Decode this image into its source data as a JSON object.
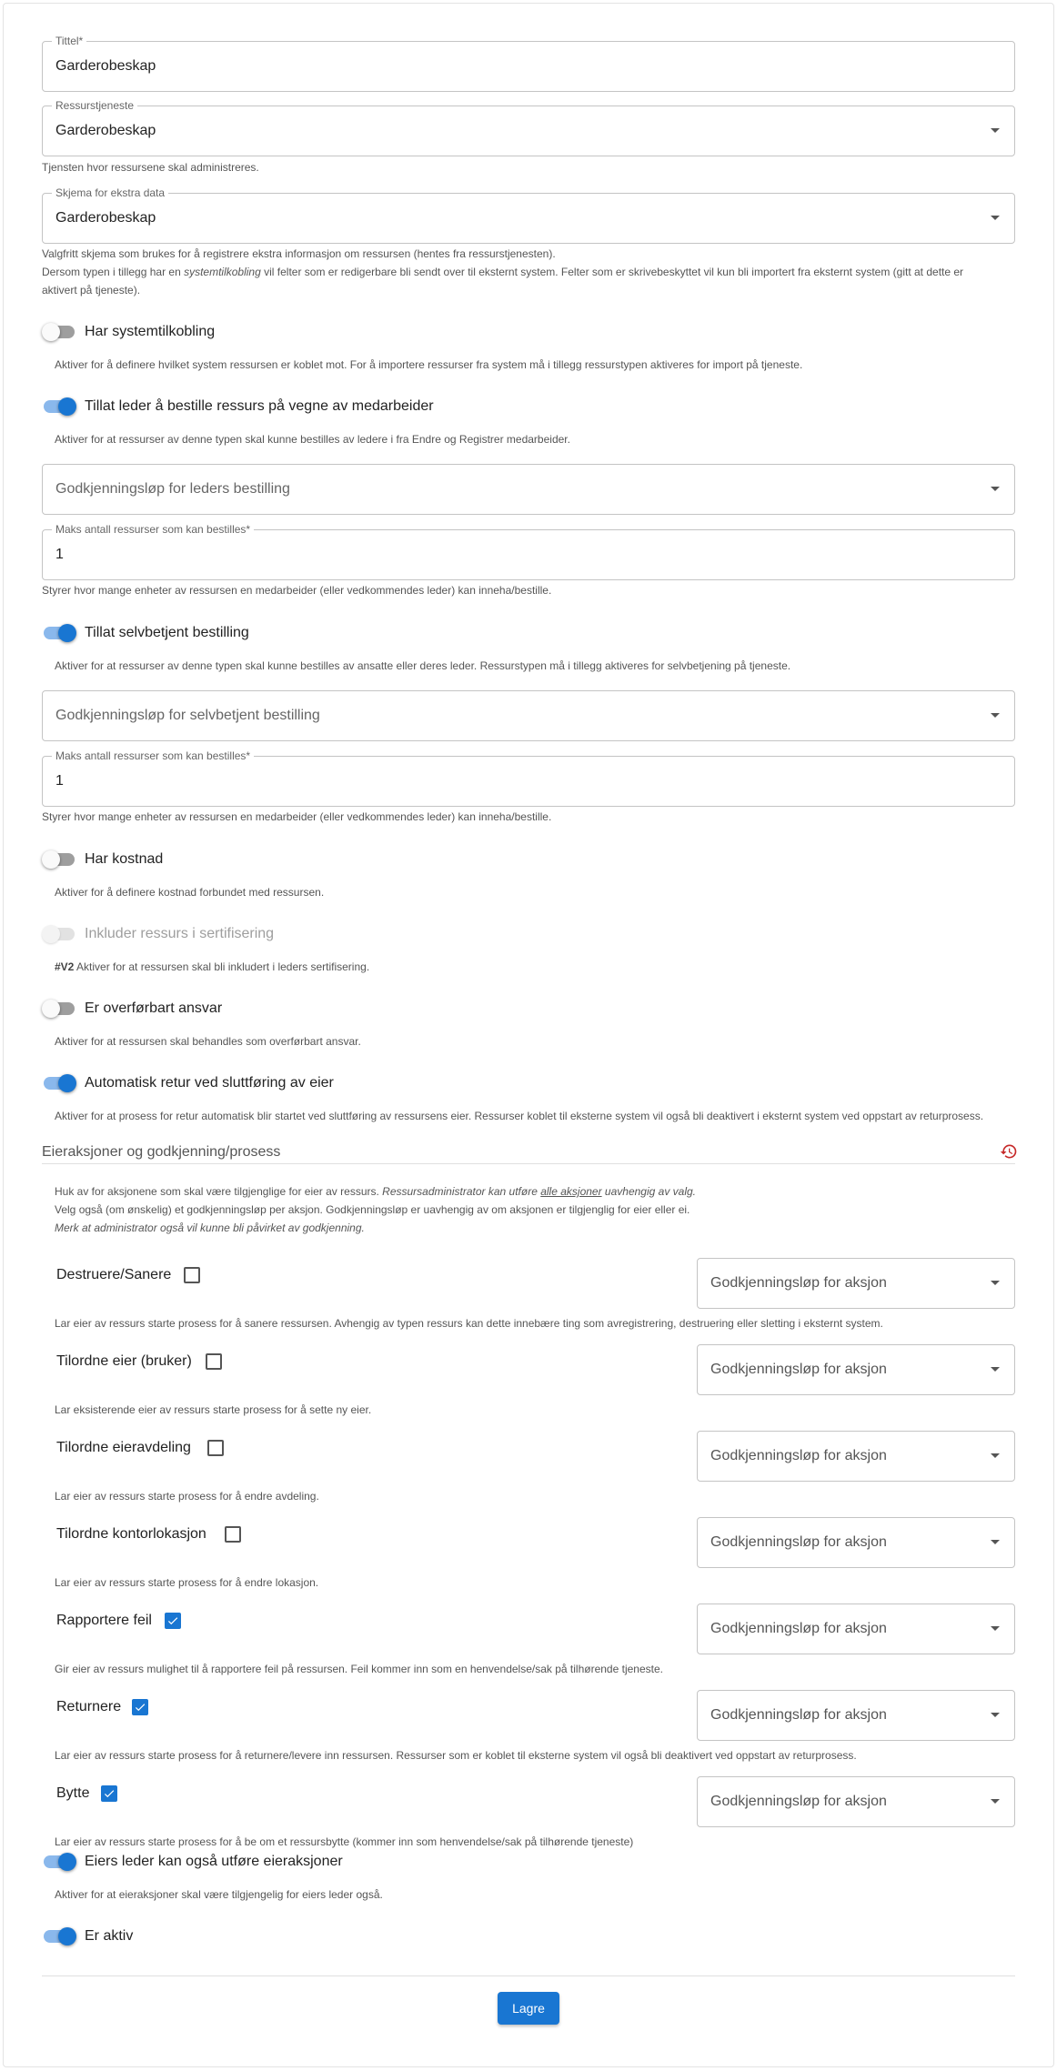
{
  "form": {
    "title_field": {
      "label": "Tittel*",
      "value": "Garderobeskap"
    },
    "resource_service": {
      "label": "Ressurstjeneste",
      "value": "Garderobeskap",
      "helper": "Tjensten hvor ressursene skal administreres."
    },
    "extra_schema": {
      "label": "Skjema for ekstra data",
      "value": "Garderobeskap",
      "helper_line1": "Valgfritt skjema som brukes for å registrere ekstra informasjon om ressursen (hentes fra ressurstjenesten).",
      "helper_line2_a": "Dersom typen i tillegg har en ",
      "helper_line2_em": "systemtilkobling",
      "helper_line2_b": " vil felter som er redigerbare bli sendt over til eksternt system. Felter som er skrivebeskyttet vil kun bli importert fra eksternt system (gitt at dette er",
      "helper_line3": "aktivert på tjeneste)."
    },
    "system_connection": {
      "label": "Har systemtilkobling",
      "checked": false,
      "helper": "Aktiver for å definere hvilket system ressursen er koblet mot. For å importere ressurser fra system må i tillegg ressurstypen aktiveres for import på tjeneste."
    },
    "manager_order": {
      "label": "Tillat leder å bestille ressurs på vegne av medarbeider",
      "checked": true,
      "helper": "Aktiver for at ressurser av denne typen skal kunne bestilles av ledere i fra Endre og Registrer medarbeider.",
      "approval_placeholder": "Godkjenningsløp for leders bestilling",
      "max_label": "Maks antall ressurser som kan bestilles*",
      "max_value": "1",
      "max_helper": "Styrer hvor mange enheter av ressursen en medarbeider (eller vedkommendes leder) kan inneha/bestille."
    },
    "self_service": {
      "label": "Tillat selvbetjent bestilling",
      "checked": true,
      "helper": "Aktiver for at ressurser av denne typen skal kunne bestilles av ansatte eller deres leder. Ressurstypen må i tillegg aktiveres for selvbetjening på tjeneste.",
      "approval_placeholder": "Godkjenningsløp for selvbetjent bestilling",
      "max_label": "Maks antall ressurser som kan bestilles*",
      "max_value": "1",
      "max_helper": "Styrer hvor mange enheter av ressursen en medarbeider (eller vedkommendes leder) kan inneha/bestille."
    },
    "has_cost": {
      "label": "Har kostnad",
      "checked": false,
      "helper": "Aktiver for å definere kostnad forbundet med ressursen."
    },
    "certification": {
      "label": "Inkluder ressurs i sertifisering",
      "checked": false,
      "disabled": true,
      "tag": "#V2",
      "helper": " Aktiver for at ressursen skal bli inkludert i leders sertifisering."
    },
    "transferable": {
      "label": "Er overførbart ansvar",
      "checked": false,
      "helper": "Aktiver for at ressursen skal behandles som overførbart ansvar."
    },
    "auto_return": {
      "label": "Automatisk retur ved sluttføring av eier",
      "checked": true,
      "helper": "Aktiver for at prosess for retur automatisk blir startet ved sluttføring av ressursens eier. Ressurser koblet til eksterne system vil også bli deaktivert i eksternt system ved oppstart av returprosess."
    },
    "owner_actions": {
      "title": "Eieraksjoner og godkjenning/prosess",
      "intro_line1_a": "Huk av for aksjonene som skal være tilgjenglige for eier av ressurs. ",
      "intro_line1_em_a": "Ressursadministrator kan utføre ",
      "intro_line1_em_u": "alle aksjoner",
      "intro_line1_em_b": " uavhengig av valg.",
      "intro_line2": "Velg også (om ønskelig) et godkjenningsløp per aksjon. Godkjenningsløp er uavhengig av om aksjonen er tilgjenglig for eier eller ei.",
      "intro_line3": "Merk at administrator også vil kunne bli påvirket av godkjenning.",
      "items": [
        {
          "label": "Destruere/Sanere",
          "checked": false,
          "approval_placeholder": "Godkjenningsløp for aksjon",
          "helper": "Lar eier av ressurs starte prosess for å sanere ressursen. Avhengig av typen ressurs kan dette innebære ting som avregistrering, destruering eller sletting i eksternt system."
        },
        {
          "label": "Tilordne eier (bruker)",
          "checked": false,
          "approval_placeholder": "Godkjenningsløp for aksjon",
          "helper": "Lar eksisterende eier av ressurs starte prosess for å sette ny eier."
        },
        {
          "label": "Tilordne eieravdeling",
          "checked": false,
          "approval_placeholder": "Godkjenningsløp for aksjon",
          "helper": "Lar eier av ressurs starte prosess for å endre avdeling."
        },
        {
          "label": "Tilordne kontorlokasjon",
          "checked": false,
          "approval_placeholder": "Godkjenningsløp for aksjon",
          "helper": "Lar eier av ressurs starte prosess for å endre lokasjon."
        },
        {
          "label": "Rapportere feil",
          "checked": true,
          "approval_placeholder": "Godkjenningsløp for aksjon",
          "helper": "Gir eier av ressurs mulighet til å rapportere feil på ressursen. Feil kommer inn som en henvendelse/sak på tilhørende tjeneste."
        },
        {
          "label": "Returnere",
          "checked": true,
          "approval_placeholder": "Godkjenningsløp for aksjon",
          "helper": "Lar eier av ressurs starte prosess for å returnere/levere inn ressursen. Ressurser som er koblet til eksterne system vil også bli deaktivert ved oppstart av returprosess."
        },
        {
          "label": "Bytte",
          "checked": true,
          "approval_placeholder": "Godkjenningsløp for aksjon",
          "helper": "Lar eier av ressurs starte prosess for å be om et ressursbytte (kommer inn som henvendelse/sak på tilhørende tjeneste)"
        }
      ]
    },
    "manager_owner_actions": {
      "label": "Eiers leder kan også utføre eieraksjoner",
      "checked": true,
      "helper": "Aktiver for at eieraksjoner skal være tilgjengelig for eiers leder også."
    },
    "is_active": {
      "label": "Er aktiv",
      "checked": true
    },
    "save_label": "Lagre"
  },
  "icons": {
    "history": "history-icon",
    "dropdown": "chevron-down-icon",
    "check": "check-icon"
  },
  "colors": {
    "primary": "#1976d2",
    "toggle_track_on": "#8ab8ec",
    "history_icon": "#c62828"
  }
}
